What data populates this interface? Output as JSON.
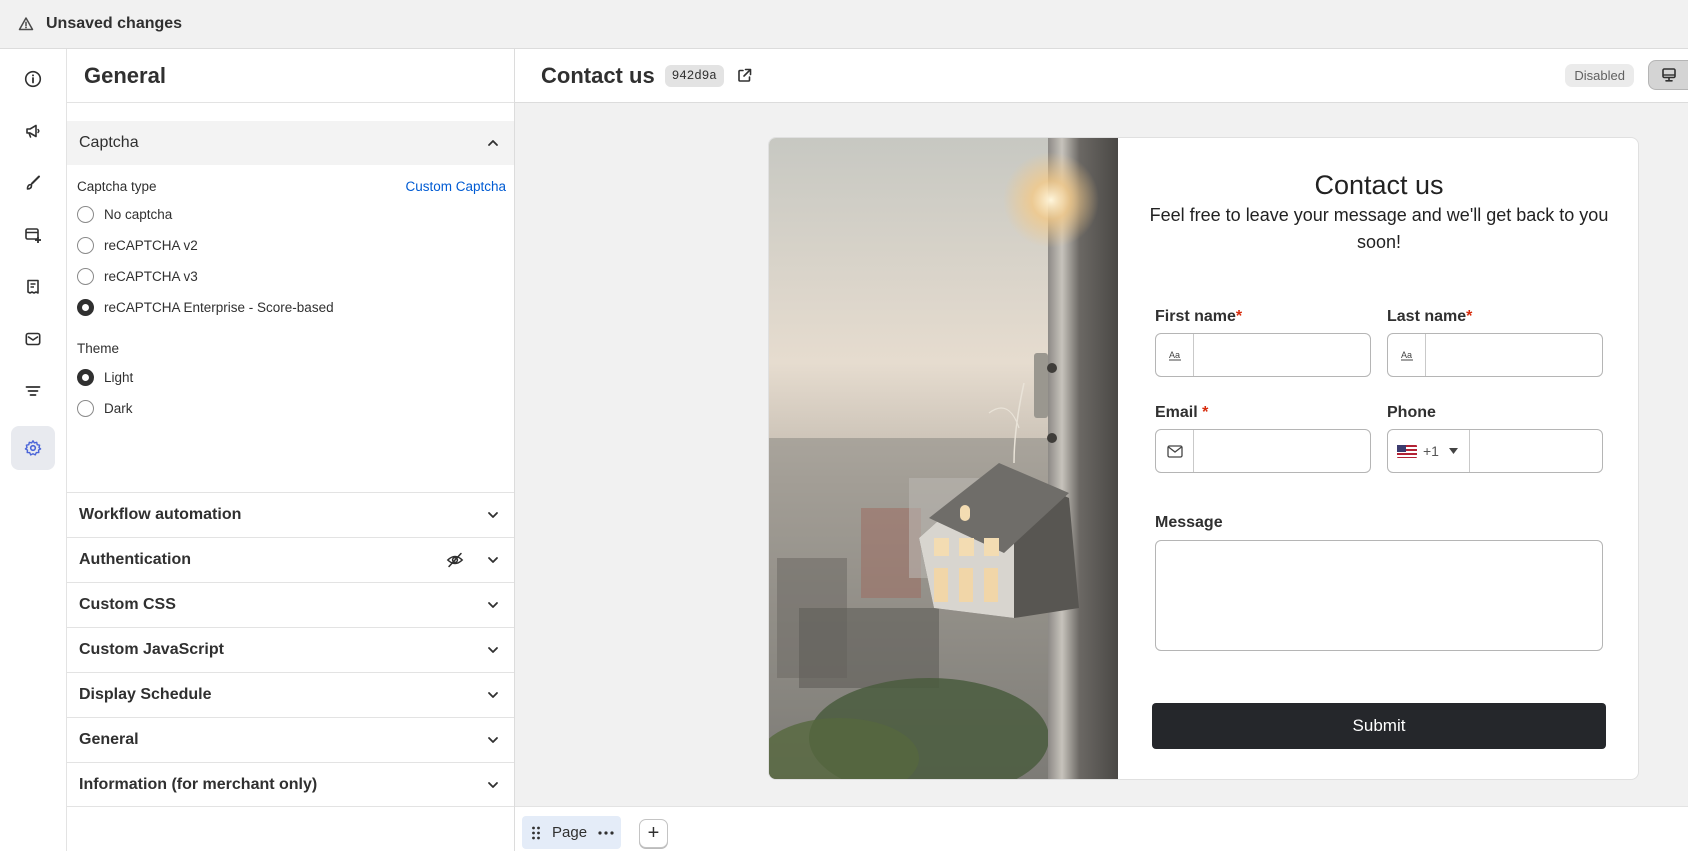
{
  "topbar": {
    "title": "Unsaved changes",
    "icon": "warning-triangle-icon"
  },
  "sidebar_rail": {
    "items": [
      {
        "icon": "info-icon"
      },
      {
        "icon": "megaphone-icon"
      },
      {
        "icon": "paintbrush-icon"
      },
      {
        "icon": "add-section-icon"
      },
      {
        "icon": "receipt-icon"
      },
      {
        "icon": "email-icon"
      },
      {
        "icon": "filter-icon"
      },
      {
        "icon": "settings-gear-icon",
        "active": true
      }
    ]
  },
  "panel": {
    "title": "General",
    "captcha": {
      "section_title": "Captcha",
      "type_label": "Captcha type",
      "custom_link": "Custom Captcha",
      "options": [
        {
          "label": "No captcha",
          "checked": false
        },
        {
          "label": "reCAPTCHA v2",
          "checked": false
        },
        {
          "label": "reCAPTCHA v3",
          "checked": false
        },
        {
          "label": "reCAPTCHA Enterprise - Score-based",
          "checked": true
        }
      ],
      "theme_label": "Theme",
      "themes": [
        {
          "label": "Light",
          "checked": true
        },
        {
          "label": "Dark",
          "checked": false
        }
      ]
    },
    "sections": [
      {
        "title": "Workflow automation"
      },
      {
        "title": "Authentication",
        "hidden_icon": "eye-slash-icon"
      },
      {
        "title": "Custom CSS"
      },
      {
        "title": "Custom JavaScript"
      },
      {
        "title": "Display Schedule"
      },
      {
        "title": "General"
      },
      {
        "title": "Information (for merchant only)"
      }
    ]
  },
  "canvas": {
    "title": "Contact us",
    "hash": "942d9a",
    "status": "Disabled"
  },
  "form": {
    "title": "Contact us",
    "subtitle": "Feel free to leave your message and we'll get back to you soon!",
    "first_name_label": "First name",
    "last_name_label": "Last name",
    "email_label": "Email",
    "phone_label": "Phone",
    "phone_code": "+1",
    "message_label": "Message",
    "required_mark": "*",
    "submit_label": "Submit"
  },
  "bottombar": {
    "page_tab_label": "Page",
    "add_label": "+"
  }
}
